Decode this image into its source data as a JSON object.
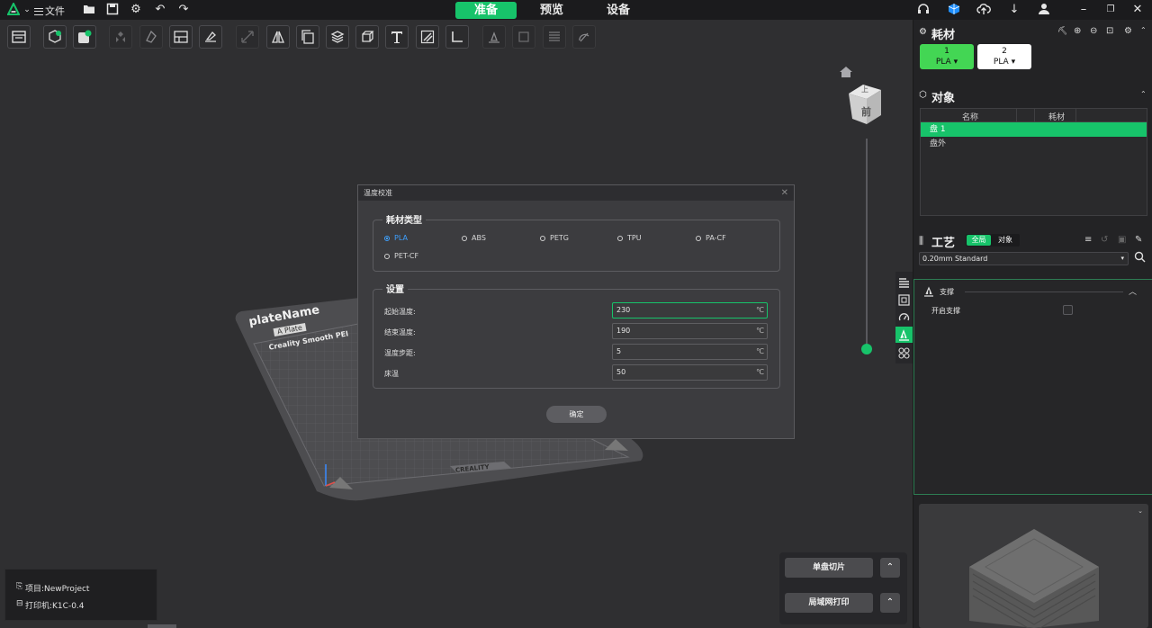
{
  "topbar": {
    "file_label": "文件",
    "tabs": [
      "准备",
      "预览",
      "设备"
    ],
    "active_tab": 0
  },
  "filament": {
    "title": "耗材",
    "slots": [
      {
        "index": "1",
        "type": "PLA ▾",
        "color": "#43d654"
      },
      {
        "index": "2",
        "type": "PLA ▾",
        "color": "#ffffff"
      }
    ]
  },
  "objects": {
    "title": "对象",
    "col_name": "名称",
    "col_filament": "耗材",
    "rows": [
      "盘 1",
      "盘外"
    ]
  },
  "process": {
    "title": "工艺",
    "toggle_global": "全局",
    "toggle_object": "对象",
    "preset": "0.20mm Standard",
    "group_title": "支撑",
    "enable_support": "开启支撑"
  },
  "project": {
    "project_label": "项目:NewProject",
    "printer_label": "打印机:K1C-0.4"
  },
  "actions": {
    "slice_label": "单盘切片",
    "print_label": "局域网打印"
  },
  "plate": {
    "name": "plateName",
    "tag": "A Plate",
    "surface": "Creality Smooth PEI",
    "brand": "CREALITY"
  },
  "viewcube": {
    "front": "前",
    "top": "上"
  },
  "dialog": {
    "title": "温度校准",
    "type_legend": "耗材类型",
    "types": [
      "PLA",
      "ABS",
      "PETG",
      "TPU",
      "PA-CF",
      "PET-CF"
    ],
    "selected_type": "PLA",
    "settings_legend": "设置",
    "fields": [
      {
        "label": "起始温度:",
        "value": "230",
        "unit": "℃"
      },
      {
        "label": "结束温度:",
        "value": "190",
        "unit": "℃"
      },
      {
        "label": "温度步距:",
        "value": "5",
        "unit": "℃"
      },
      {
        "label": "床温",
        "value": "50",
        "unit": "℃"
      }
    ],
    "ok_label": "确定"
  },
  "colors": {
    "accent": "#17c36a",
    "bed": "#4d4d50",
    "selection_blue": "#3ea0ff"
  }
}
